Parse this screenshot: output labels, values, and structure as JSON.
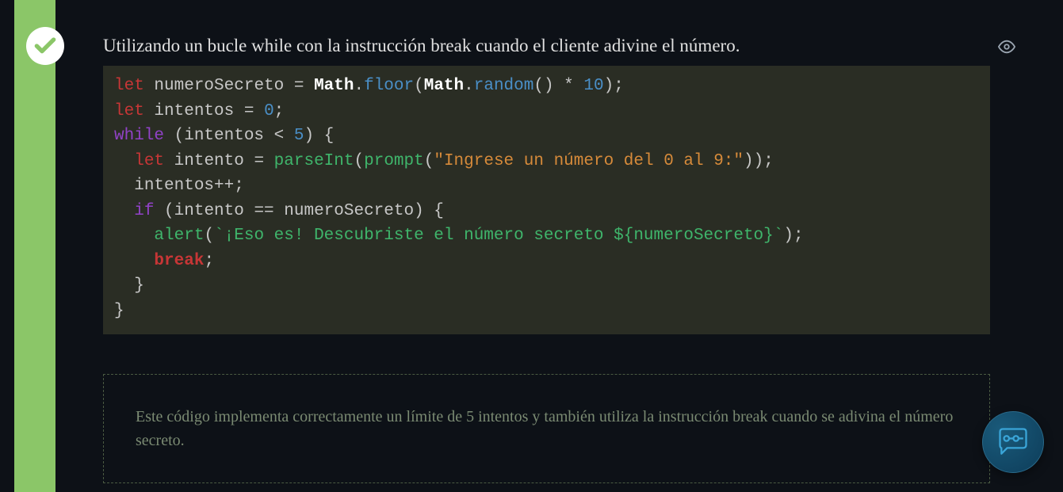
{
  "title": "Utilizando un bucle while con la instrucción break cuando el cliente adivine el número.",
  "feedback": "Este código implementa correctamente un límite de 5 intentos y también utiliza la instrucción break cuando se adivina el número secreto.",
  "code": {
    "line1": {
      "kw": "let",
      "var": "numeroSecreto",
      "op1": " = ",
      "obj1": "Math",
      "dot1": ".",
      "m1": "floor",
      "p1": "(",
      "obj2": "Math",
      "dot2": ".",
      "m2": "random",
      "p2": "() * ",
      "n1": "10",
      "p3": ");"
    },
    "line2": {
      "kw": "let",
      "var": "intentos",
      "op": " = ",
      "n": "0",
      "semi": ";"
    },
    "line3": {
      "kw": "while",
      "p1": " (intentos < ",
      "n": "5",
      "p2": ") {"
    },
    "line4": {
      "kw": "let",
      "var": "intento",
      "op": " = ",
      "f1": "parseInt",
      "p1": "(",
      "f2": "prompt",
      "p2": "(",
      "str": "\"Ingrese un número del 0 al 9:\"",
      "p3": "));"
    },
    "line5": {
      "txt": "intentos++;"
    },
    "line6": {
      "kw": "if",
      "txt": " (intento == numeroSecreto) {"
    },
    "line7": {
      "f": "alert",
      "p1": "(",
      "tmpl": "`¡Eso es! Descubriste el número secreto ${numeroSecreto}`",
      "p2": ");"
    },
    "line8": {
      "kw": "break",
      "semi": ";"
    },
    "line9": {
      "txt": "}"
    },
    "line10": {
      "txt": "}"
    }
  },
  "icons": {
    "check": "check",
    "eye": "eye",
    "chat": "chat"
  }
}
